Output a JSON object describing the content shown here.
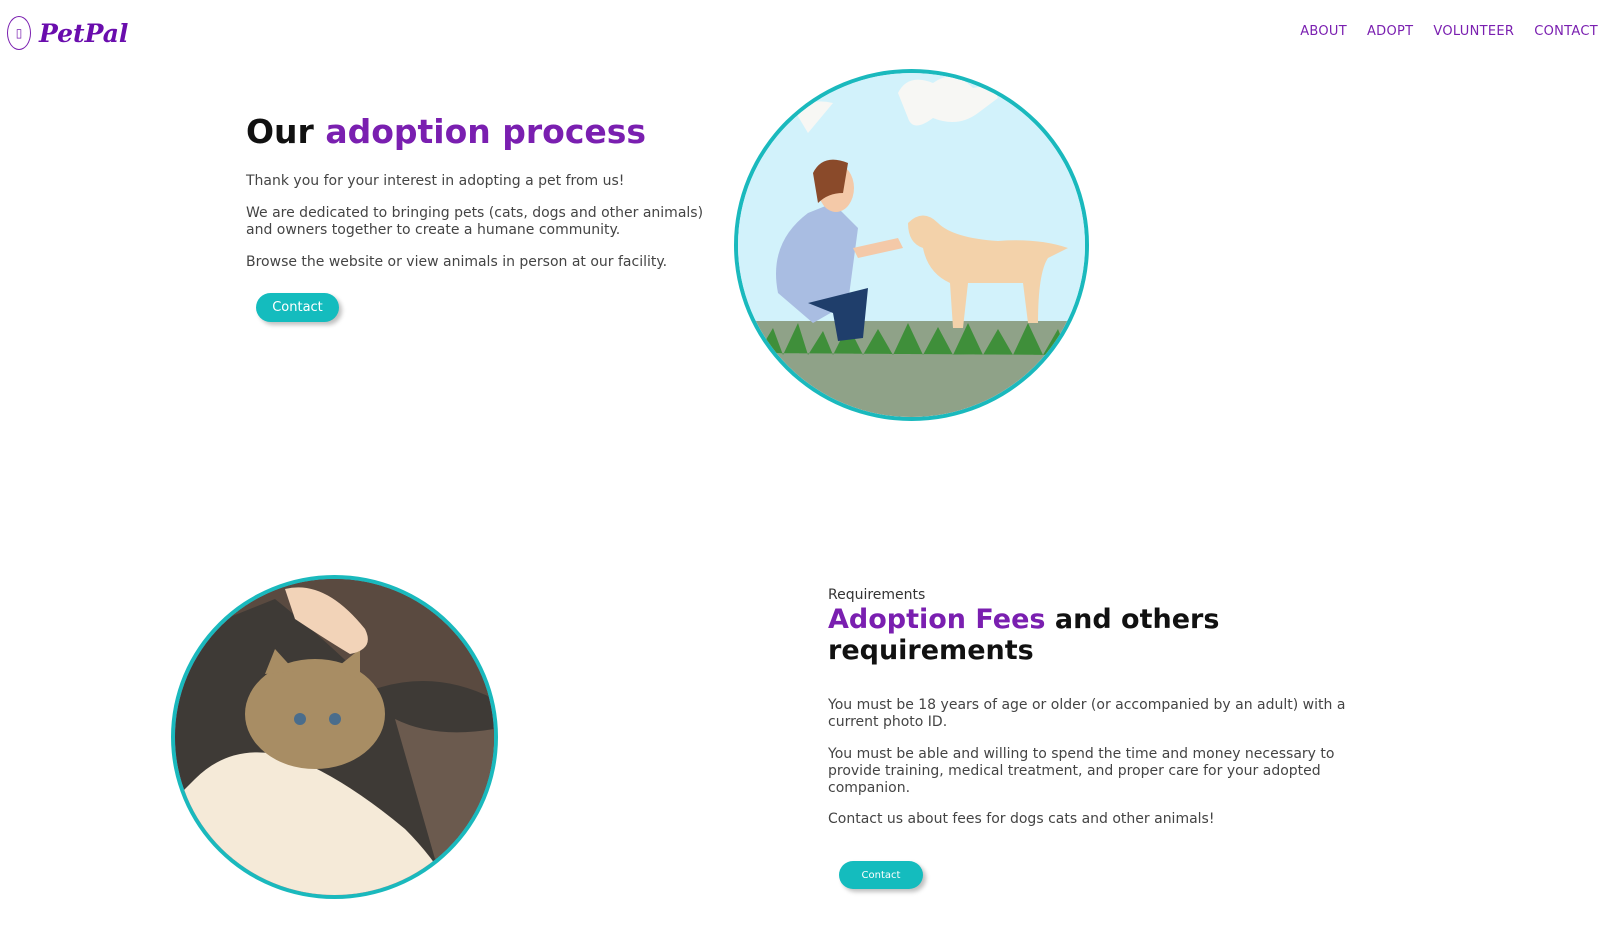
{
  "brand": {
    "name": "PetPal",
    "icon": "phone-outline-icon"
  },
  "nav": [
    "ABOUT",
    "ADOPT",
    "VOLUNTEER",
    "CONTACT"
  ],
  "hero": {
    "title_plain": "Our",
    "title_accent": "adoption process",
    "paragraphs": [
      "Thank you for your interest in adopting a pet from us!",
      "We are dedicated to bringing pets (cats, dogs and other animals) and owners together to create a humane community.",
      "Browse the website or view animals in person at our facility."
    ],
    "button": "Contact"
  },
  "requirements": {
    "eyebrow": "Requirements",
    "title_accent": "Adoption Fees",
    "title_plain": "and others requirements",
    "paragraphs": [
      "You must be 18 years of age or older (or accompanied by an adult) with a current photo ID.",
      "You must be able and willing to spend the time and money necessary to provide training, medical treatment, and proper care for your adopted companion.",
      "Contact us about fees for dogs cats and other animals!"
    ],
    "button": "Contact"
  },
  "colors": {
    "accent": "#7a1fb0",
    "button": "#14bcbe",
    "circle_border": "#1ab9bd"
  }
}
